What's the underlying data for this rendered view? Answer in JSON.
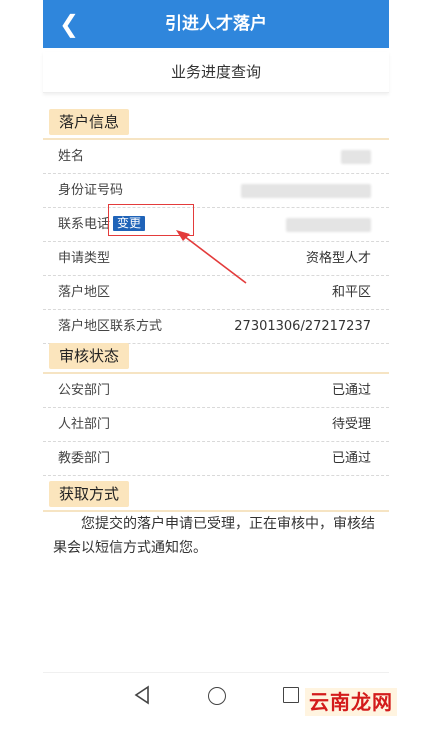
{
  "header": {
    "title": "引进人才落户",
    "back_icon": "chevron-left-icon"
  },
  "subtitle": "业务进度查询",
  "sections": {
    "household": {
      "title": "落户信息",
      "rows": [
        {
          "label": "姓名",
          "value": ""
        },
        {
          "label": "身份证号码",
          "value": ""
        },
        {
          "label": "联系电话",
          "value": "",
          "badge": "变更"
        },
        {
          "label": "申请类型",
          "value": "资格型人才"
        },
        {
          "label": "落户地区",
          "value": "和平区"
        },
        {
          "label": "落户地区联系方式",
          "value": "27301306/27217237"
        }
      ]
    },
    "review": {
      "title": "审核状态",
      "rows": [
        {
          "label": "公安部门",
          "value": "已通过"
        },
        {
          "label": "人社部门",
          "value": "待受理"
        },
        {
          "label": "教委部门",
          "value": "已通过"
        }
      ]
    },
    "pickup": {
      "title": "获取方式",
      "text": "您提交的落户申请已受理，正在审核中，审核结果会以短信方式通知您。"
    }
  },
  "annotation": {
    "color": "#e33b3b"
  },
  "nav": {
    "back_icon": "triangle-back-icon",
    "home_icon": "circle-home-icon",
    "recent_icon": "square-recent-icon"
  },
  "watermark": "云南龙网",
  "colors": {
    "header_bg": "#2f86dc",
    "section_tag_bg": "#fbe5bd",
    "badge_bg": "#1f63b8"
  }
}
